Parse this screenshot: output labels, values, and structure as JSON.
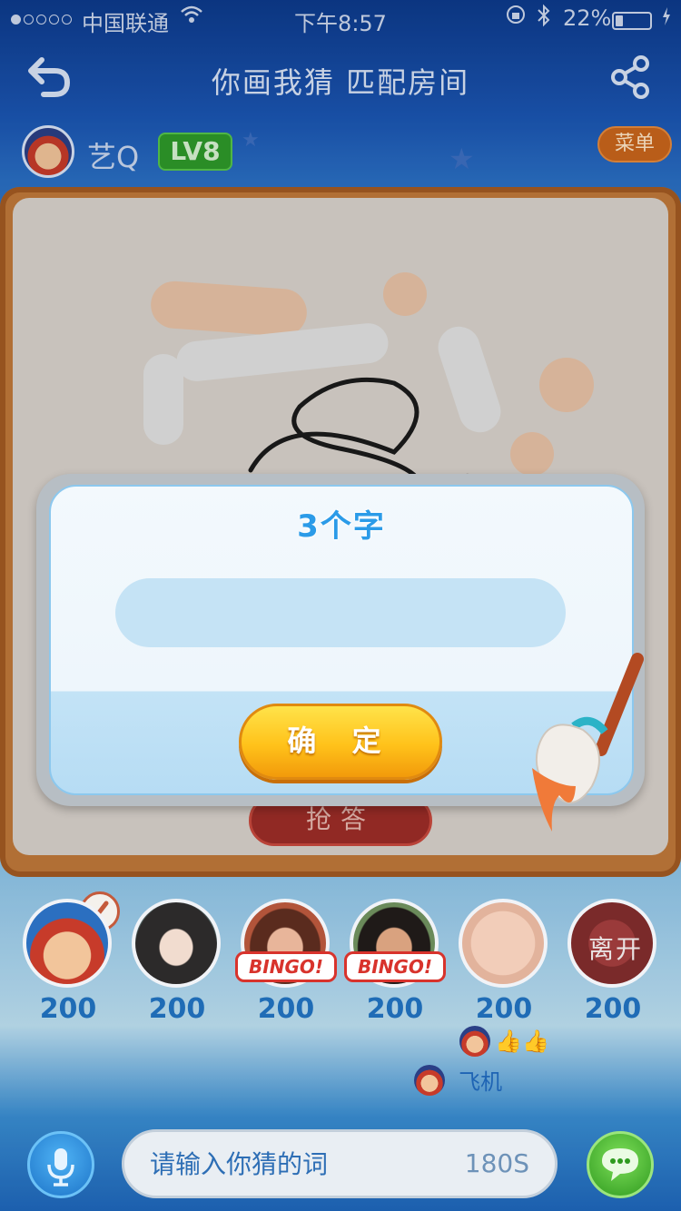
{
  "status_bar": {
    "carrier": "中国联通",
    "time": "下午8:57",
    "battery": "22%",
    "battery_level": 0.22,
    "signal_bars_filled": 1
  },
  "nav": {
    "title": "你画我猜  匹配房间"
  },
  "player": {
    "name": "艺Q",
    "level": "LV8"
  },
  "menu": {
    "label": "菜单"
  },
  "board": {
    "answer_label": "抢答"
  },
  "dialog": {
    "title": "3个字",
    "input_value": "",
    "confirm_label": "确 定"
  },
  "players": [
    {
      "score": "200",
      "avatar": "cartoon-avatar",
      "bingo": ""
    },
    {
      "score": "200",
      "avatar": "woman-avatar",
      "bingo": ""
    },
    {
      "score": "200",
      "avatar": "girl-avatar",
      "bingo": "BINGO!"
    },
    {
      "score": "200",
      "avatar": "woman-avatar-2",
      "bingo": "BINGO!"
    },
    {
      "score": "200",
      "avatar": "face-avatar",
      "bingo": ""
    },
    {
      "score": "200",
      "avatar": "empty-seat",
      "bingo": "",
      "leave_label": "离开"
    }
  ],
  "reactions": {
    "thumbs": "👍👍",
    "gift_label": "飞机"
  },
  "bottom": {
    "input_placeholder": "请输入你猜的词",
    "timer": "180S"
  },
  "colors": {
    "accent_blue": "#2b9be8",
    "confirm_yellow": "#ffc21a",
    "board_wood": "#c0793a",
    "score_blue": "#1f6cb6"
  }
}
